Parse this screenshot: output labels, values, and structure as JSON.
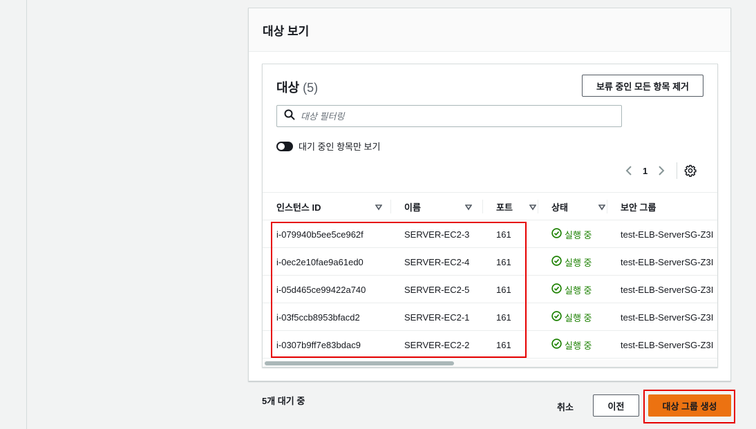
{
  "panel": {
    "title": "대상 보기"
  },
  "targets": {
    "title": "대상",
    "count": "(5)",
    "remove_all_label": "보류 중인 모든 항목 제거",
    "filter_placeholder": "대상 필터링",
    "toggle_label": "대기 중인 항목만 보기",
    "page_number": "1"
  },
  "table": {
    "columns": [
      "인스턴스 ID",
      "이름",
      "포트",
      "상태",
      "보안 그룹"
    ],
    "rows": [
      {
        "instance_id": "i-079940b5ee5ce962f",
        "name": "SERVER-EC2-3",
        "port": "161",
        "status": "실행 중",
        "security_group": "test-ELB-ServerSG-Z3I"
      },
      {
        "instance_id": "i-0ec2e10fae9a61ed0",
        "name": "SERVER-EC2-4",
        "port": "161",
        "status": "실행 중",
        "security_group": "test-ELB-ServerSG-Z3I"
      },
      {
        "instance_id": "i-05d465ce99422a740",
        "name": "SERVER-EC2-5",
        "port": "161",
        "status": "실행 중",
        "security_group": "test-ELB-ServerSG-Z3I"
      },
      {
        "instance_id": "i-03f5ccb8953bfacd2",
        "name": "SERVER-EC2-1",
        "port": "161",
        "status": "실행 중",
        "security_group": "test-ELB-ServerSG-Z3I"
      },
      {
        "instance_id": "i-0307b9ff7e83bdac9",
        "name": "SERVER-EC2-2",
        "port": "161",
        "status": "실행 중",
        "security_group": "test-ELB-ServerSG-Z3I"
      }
    ]
  },
  "footer": {
    "pending_text": "5개 대기 중",
    "cancel_label": "취소",
    "previous_label": "이전",
    "create_label": "대상 그룹 생성"
  },
  "colors": {
    "primary_button": "#ec7211",
    "status_running": "#1d8102",
    "highlight": "#e60000"
  },
  "icons": {
    "search": "search-icon",
    "status": "check-circle-icon",
    "sort": "sort-triangle-icon",
    "settings": "gear-icon",
    "prev_page": "chevron-left-icon",
    "next_page": "chevron-right-icon"
  }
}
